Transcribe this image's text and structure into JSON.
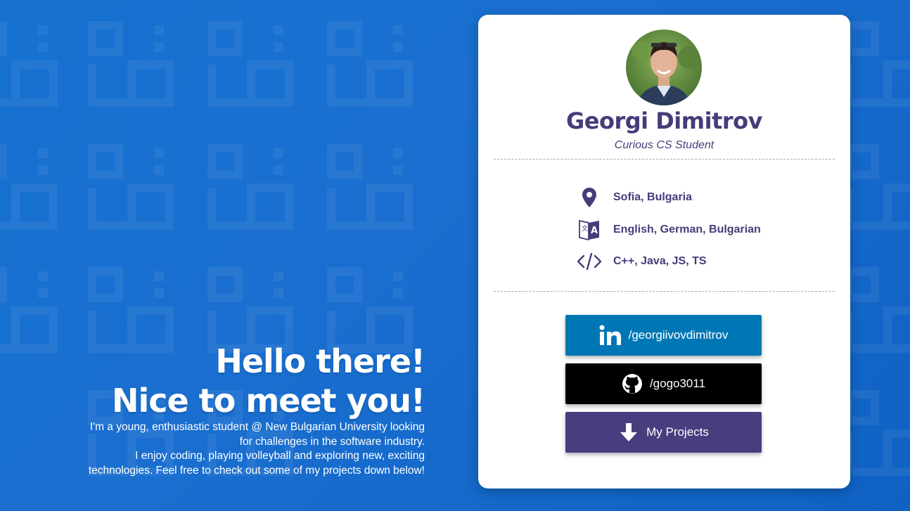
{
  "intro": {
    "headline_1": "Hello there!",
    "headline_2": "Nice to meet you!",
    "bio_lines": [
      "I'm a young, enthusiastic student @ New Bulgarian University looking",
      "for challenges in the software industry.",
      "I enjoy coding, playing volleyball and exploring new, exciting",
      "technologies. Feel free to check out some of my projects down below!"
    ]
  },
  "profile": {
    "name": "Georgi Dimitrov",
    "subtitle": "Curious CS Student",
    "info": {
      "location": "Sofia, Bulgaria",
      "languages": "English, German, Bulgarian",
      "skills": "C++, Java, JS, TS"
    },
    "links": {
      "linkedin": "/georgiivovdimitrov",
      "github": "/gogo3011",
      "projects": "My Projects"
    }
  },
  "icons": {
    "location": "map-pin-icon",
    "languages": "translate-icon",
    "skills": "code-icon",
    "linkedin": "linkedin-icon",
    "github": "github-icon",
    "projects": "arrow-down-icon"
  },
  "colors": {
    "background": "#1671cf",
    "accent": "#453d7a",
    "linkedin": "#0077b5",
    "github": "#000000",
    "projects": "#4a3d7f"
  }
}
